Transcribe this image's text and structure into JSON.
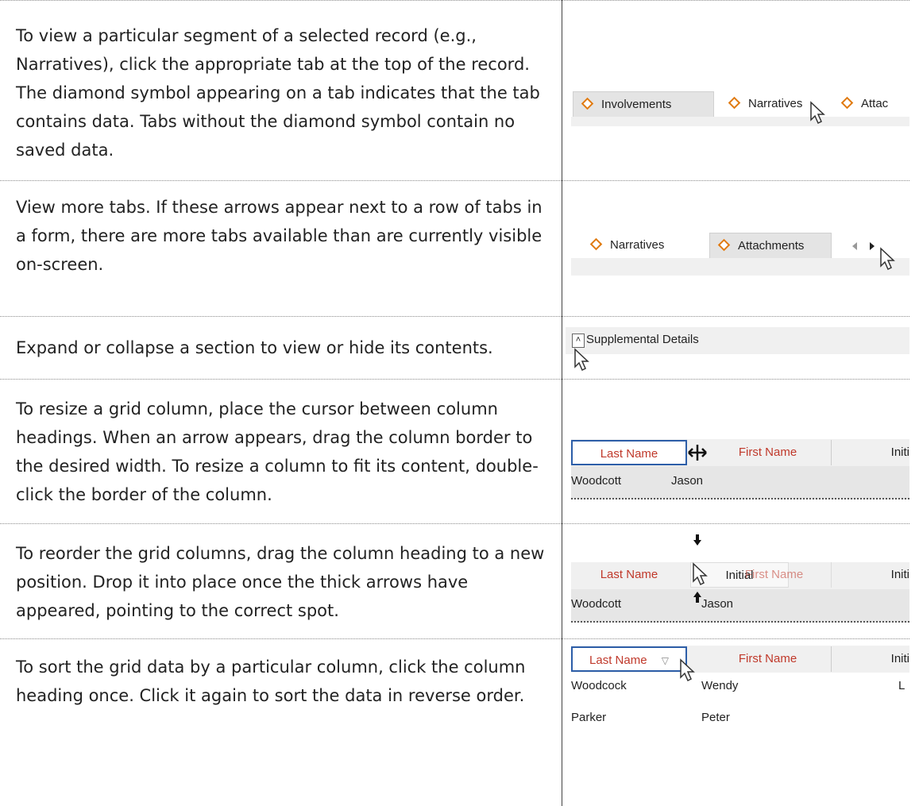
{
  "rows": [
    {
      "description": "To view a particular segment of a selected record (e.g., Narratives), click the appropriate tab at the top of the record. The diamond symbol appearing on a tab indicates that the tab contains data. Tabs without the diamond symbol contain no saved data.",
      "tabs": [
        "Involvements",
        "Narratives",
        "Attac"
      ]
    },
    {
      "description": "View more tabs. If these arrows appear next to a row of tabs in a form, there are more tabs available than are currently visible on-screen.",
      "tabs": [
        "Narratives",
        "Attachments"
      ]
    },
    {
      "description": "Expand or collapse a section to view or hide its contents.",
      "section_label": "Supplemental Details"
    },
    {
      "description": "To resize a grid column, place the cursor between column headings. When an arrow appears, drag the column border to the desired width. To resize a column to fit its content, double-click the border of the column.",
      "headers": [
        "Last Name",
        "First Name",
        "Initi"
      ],
      "cells": [
        "Woodcott",
        "Jason"
      ]
    },
    {
      "description": "To reorder the grid columns, drag the column heading to a new position. Drop it into place once the thick arrows have appeared, pointing to the correct spot.",
      "headers": [
        "Last Name",
        "Initial",
        "First Name",
        "Initi"
      ],
      "cells": [
        "Woodcott",
        "Jason"
      ]
    },
    {
      "description": "To sort the grid data by a particular column, click the column heading once. Click it again to sort the data in reverse order.",
      "headers": [
        "Last Name",
        "First Name",
        "Initi"
      ],
      "data_rows": [
        [
          "Woodcock",
          "Wendy",
          "L"
        ],
        [
          "Parker",
          "Peter"
        ]
      ]
    }
  ]
}
